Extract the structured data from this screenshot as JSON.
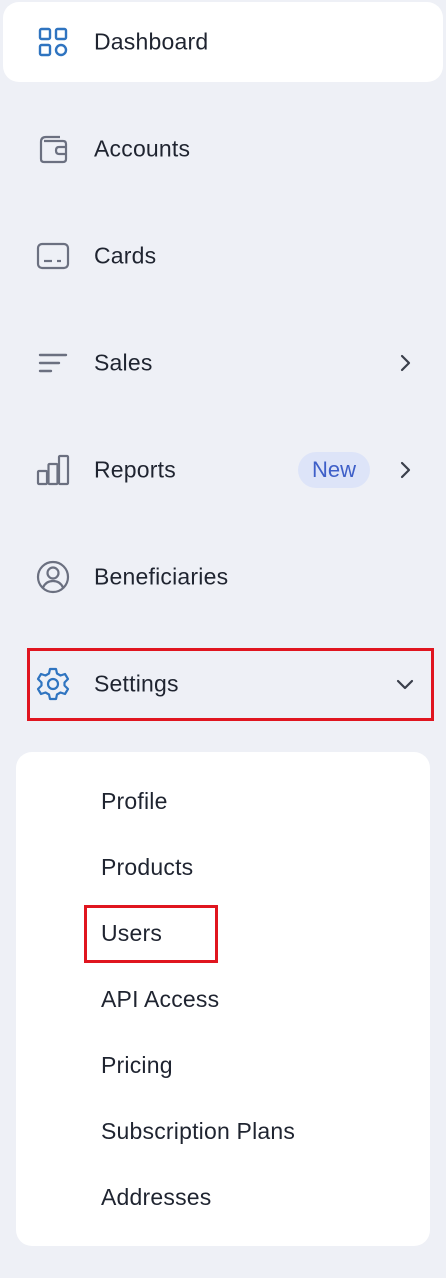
{
  "nav": {
    "items": [
      {
        "label": "Dashboard",
        "icon": "grid-icon"
      },
      {
        "label": "Accounts",
        "icon": "wallet-icon"
      },
      {
        "label": "Cards",
        "icon": "card-icon"
      },
      {
        "label": "Sales",
        "icon": "lines-icon"
      },
      {
        "label": "Reports",
        "icon": "bar-chart-icon",
        "badge": "New"
      },
      {
        "label": "Beneficiaries",
        "icon": "user-circle-icon"
      },
      {
        "label": "Settings",
        "icon": "gear-icon"
      }
    ]
  },
  "settings_submenu": {
    "items": [
      "Profile",
      "Products",
      "Users",
      "API Access",
      "Pricing",
      "Subscription Plans",
      "Addresses"
    ]
  },
  "colors": {
    "accent": "#2f74c0",
    "highlight": "#e0151f",
    "badge_bg": "#dde4f8",
    "badge_text": "#3e5fc8"
  }
}
